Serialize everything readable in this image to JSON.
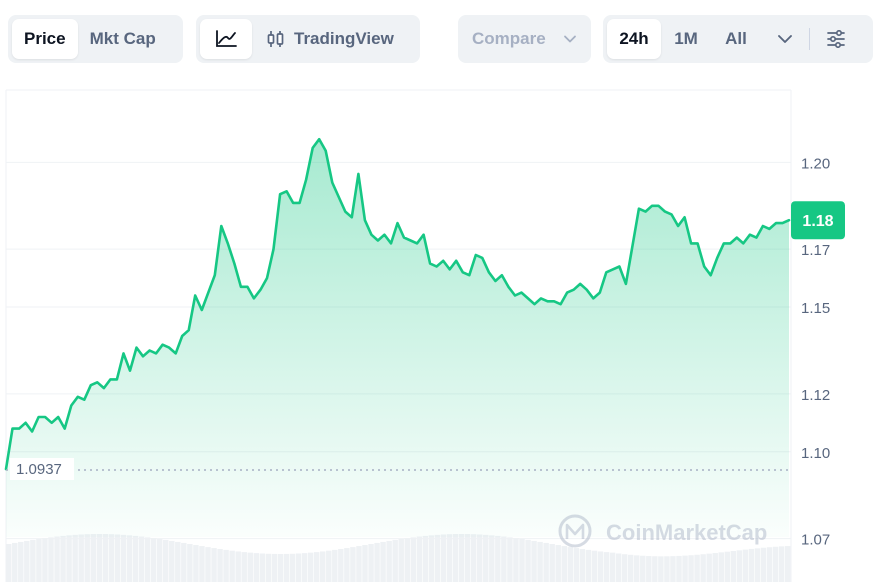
{
  "toolbar": {
    "mode_tabs": [
      "Price",
      "Mkt Cap"
    ],
    "active_mode": "Price",
    "tradingview_label": "TradingView",
    "compare_label": "Compare",
    "range_tabs": [
      "24h",
      "1M",
      "All"
    ],
    "active_range": "24h"
  },
  "chart": {
    "current_price_label": "1.18",
    "open_price_label": "1.0937",
    "watermark": "CoinMarketCap",
    "accent": "#16c784",
    "y_ticks": [
      "1.20",
      "1.17",
      "1.15",
      "1.12",
      "1.10",
      "1.07"
    ]
  },
  "chart_data": {
    "type": "area",
    "y_ticks": [
      1.2,
      1.17,
      1.15,
      1.12,
      1.1,
      1.07
    ],
    "ylim": [
      1.055,
      1.225
    ],
    "reference_line": 1.0937,
    "last_value": 1.18,
    "values": [
      1.094,
      1.108,
      1.108,
      1.11,
      1.107,
      1.112,
      1.112,
      1.11,
      1.112,
      1.108,
      1.116,
      1.119,
      1.118,
      1.123,
      1.124,
      1.122,
      1.125,
      1.125,
      1.134,
      1.128,
      1.136,
      1.133,
      1.135,
      1.134,
      1.137,
      1.136,
      1.134,
      1.14,
      1.142,
      1.154,
      1.149,
      1.155,
      1.161,
      1.178,
      1.172,
      1.165,
      1.157,
      1.157,
      1.153,
      1.156,
      1.16,
      1.17,
      1.189,
      1.19,
      1.186,
      1.186,
      1.194,
      1.205,
      1.208,
      1.204,
      1.193,
      1.188,
      1.183,
      1.181,
      1.196,
      1.18,
      1.175,
      1.173,
      1.175,
      1.172,
      1.179,
      1.174,
      1.173,
      1.172,
      1.175,
      1.165,
      1.164,
      1.166,
      1.163,
      1.166,
      1.162,
      1.161,
      1.168,
      1.167,
      1.162,
      1.159,
      1.161,
      1.157,
      1.154,
      1.155,
      1.153,
      1.151,
      1.153,
      1.152,
      1.152,
      1.151,
      1.155,
      1.156,
      1.158,
      1.156,
      1.153,
      1.155,
      1.162,
      1.163,
      1.164,
      1.158,
      1.171,
      1.184,
      1.183,
      1.185,
      1.185,
      1.183,
      1.182,
      1.178,
      1.181,
      1.172,
      1.172,
      1.164,
      1.161,
      1.167,
      1.172,
      1.172,
      1.174,
      1.172,
      1.175,
      1.174,
      1.178,
      1.177,
      1.179,
      1.179,
      1.18
    ]
  }
}
